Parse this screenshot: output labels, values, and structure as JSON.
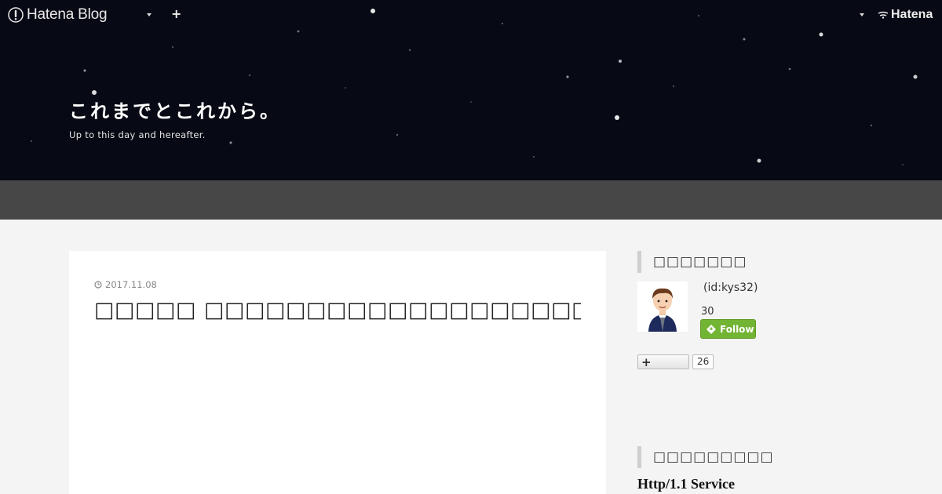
{
  "topbar": {
    "logo_text": "Hatena Blog",
    "add_label": "+",
    "hatena_label": "Hatena"
  },
  "header": {
    "title": "これまでとこれから。",
    "description": "Up to this day and hereafter."
  },
  "article": {
    "date": "2017.11.08",
    "title": "□□□□□ □□□□□□□□□□□□□□□□□□□□□□□□□□□□□□□□□□"
  },
  "sidebar": {
    "about_title": "□□□□□□□",
    "user_id": "(id:kys32)",
    "follower_count": "30",
    "follow_label": "Follow",
    "subscribe_label": "+",
    "subscribe_count": "26",
    "links_title": "□□□□□□□□□",
    "link_text": "Http/1.1 Service"
  },
  "colors": {
    "hero_bg": "#070a14",
    "navbar_bg": "#474747",
    "page_bg": "#f4f4f4",
    "follow_green": "#72b433"
  },
  "icons": [
    "hatena-blog-logo-icon",
    "chevron-down-icon",
    "plus-icon",
    "hatena-logo-icon",
    "clock-icon",
    "hatena-follow-icon",
    "user-avatar"
  ]
}
